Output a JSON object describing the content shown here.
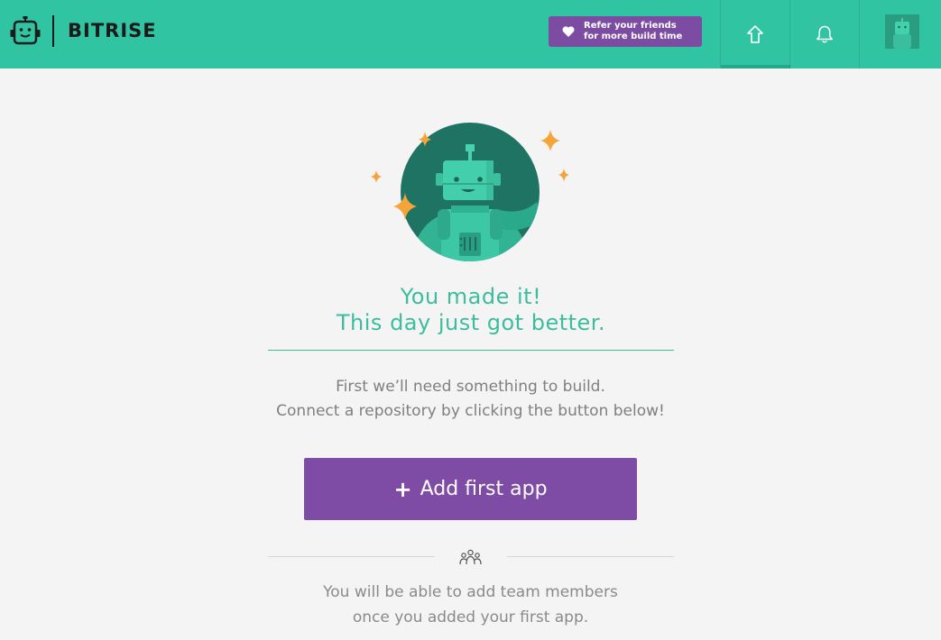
{
  "header": {
    "brand": "BITRISE",
    "refer": {
      "line1": "Refer your friends",
      "line2": "for more build time"
    }
  },
  "nav": {
    "items": [
      "home-icon",
      "bell-icon",
      "avatar"
    ]
  },
  "main": {
    "headline_line1": "You made it!",
    "headline_line2": "This day just got better.",
    "intro_line1": "First we’ll need something to build.",
    "intro_line2": "Connect a repository by clicking the button below!",
    "add_button_label": "Add first app",
    "team_line1": "You will be able to add team members",
    "team_line2": "once you added your first app."
  },
  "colors": {
    "brand_green": "#31c4a2",
    "accent_purple": "#7f4ca5",
    "headline_teal": "#3cbd9d",
    "sparkle_orange": "#f5a43a"
  }
}
